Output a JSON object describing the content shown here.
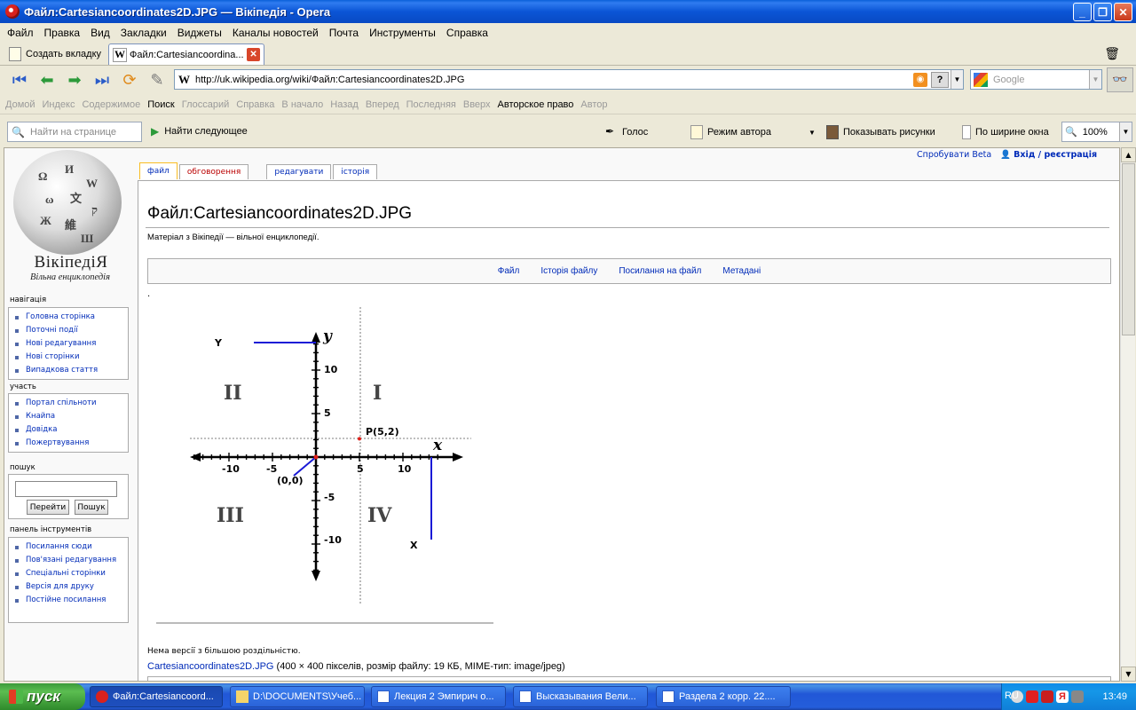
{
  "window": {
    "title": "Файл:Cartesiancoordinates2D.JPG — Вікіпедія - Opera",
    "min": "_",
    "max": "❐",
    "close": "✕"
  },
  "menu": [
    "Файл",
    "Правка",
    "Вид",
    "Закладки",
    "Виджеты",
    "Каналы новостей",
    "Почта",
    "Инструменты",
    "Справка"
  ],
  "tabs": {
    "new_tab": "Создать вкладку",
    "active_label": "Файл:Cartesiancoordina..."
  },
  "address": {
    "url": "http://uk.wikipedia.org/wiki/Файл:Cartesiancoordinates2D.JPG",
    "search_placeholder": "Google"
  },
  "navlinks": {
    "items": [
      "Домой",
      "Индекс",
      "Содержимое",
      "Поиск",
      "Глоссарий",
      "Справка",
      "В начало",
      "Назад",
      "Вперед",
      "Последняя",
      "Вверх",
      "Авторское право",
      "Автор"
    ],
    "active": [
      "Поиск",
      "Авторское право"
    ]
  },
  "findbar": {
    "placeholder": "Найти на странице",
    "find_next": "Найти следующее",
    "voice": "Голос",
    "author_mode": "Режим автора",
    "show_images": "Показывать рисунки",
    "fit_width": "По ширине окна",
    "zoom": "100%"
  },
  "wiki": {
    "logo_word": "ВікіпедіЯ",
    "logo_sub": "Вільна енциклопедія",
    "personal": {
      "beta": "Спробувати Beta",
      "login": "Вхід / реєстрація"
    },
    "page_tabs": [
      "файл",
      "обговорення",
      "редагувати",
      "історія"
    ],
    "title": "Файл:Cartesiancoordinates2D.JPG",
    "site_sub": "Матеріал з Вікіпедії — вільної енциклопедії.",
    "file_toc": [
      "Файл",
      "Історія файлу",
      "Посилання на файл",
      "Метадані"
    ],
    "dot": ".",
    "no_higher": "Нема версії з більшою роздільністю.",
    "file_link": "Cartesiancoordinates2D.JPG",
    "file_meta": " (400 × 400 пікселів, розмір файлу: 19 КБ, MIME-тип: image/jpeg)",
    "nav_heading": "навігація",
    "nav_items": [
      "Головна сторінка",
      "Поточні події",
      "Нові редагування",
      "Нові сторінки",
      "Випадкова стаття"
    ],
    "part_heading": "участь",
    "part_items": [
      "Портал спільноти",
      "Кнайпа",
      "Довідка",
      "Пожертвування"
    ],
    "search_heading": "пошук",
    "search_go": "Перейти",
    "search_btn": "Пошук",
    "tools_heading": "панель інструментів",
    "tools_items": [
      "Посилання сюди",
      "Пов'язані редагування",
      "Спеціальні сторінки",
      "Версія для друку",
      "Постійне посилання"
    ]
  },
  "figure": {
    "y_axis_label": "y",
    "x_axis_label": "x",
    "y_tag": "Y",
    "x_tag": "X",
    "x_ticks": [
      "-10",
      "-5",
      "5",
      "10"
    ],
    "y_ticks": [
      "10",
      "5",
      "-5",
      "-10"
    ],
    "quadrants": [
      "I",
      "II",
      "III",
      "IV"
    ],
    "point_label": "P(5,2)",
    "origin_label": "(0,0)",
    "point": {
      "x": 5,
      "y": 2
    }
  },
  "taskbar": {
    "start": "пуск",
    "tasks": [
      "Файл:Cartesiancoord...",
      "D:\\DOCUMENTS\\Учеб...",
      "Лекция 2 Эмпирич о...",
      "Высказывания Вели...",
      "Раздела 2 корр. 22...."
    ],
    "lang": "RU",
    "clock": "13:49"
  },
  "colors": {
    "title_bar": "#0b55d6",
    "link": "#002bb8",
    "red_link": "#ba0000",
    "axis_blue": "#1a1ad6",
    "point_red": "#e0201a"
  }
}
